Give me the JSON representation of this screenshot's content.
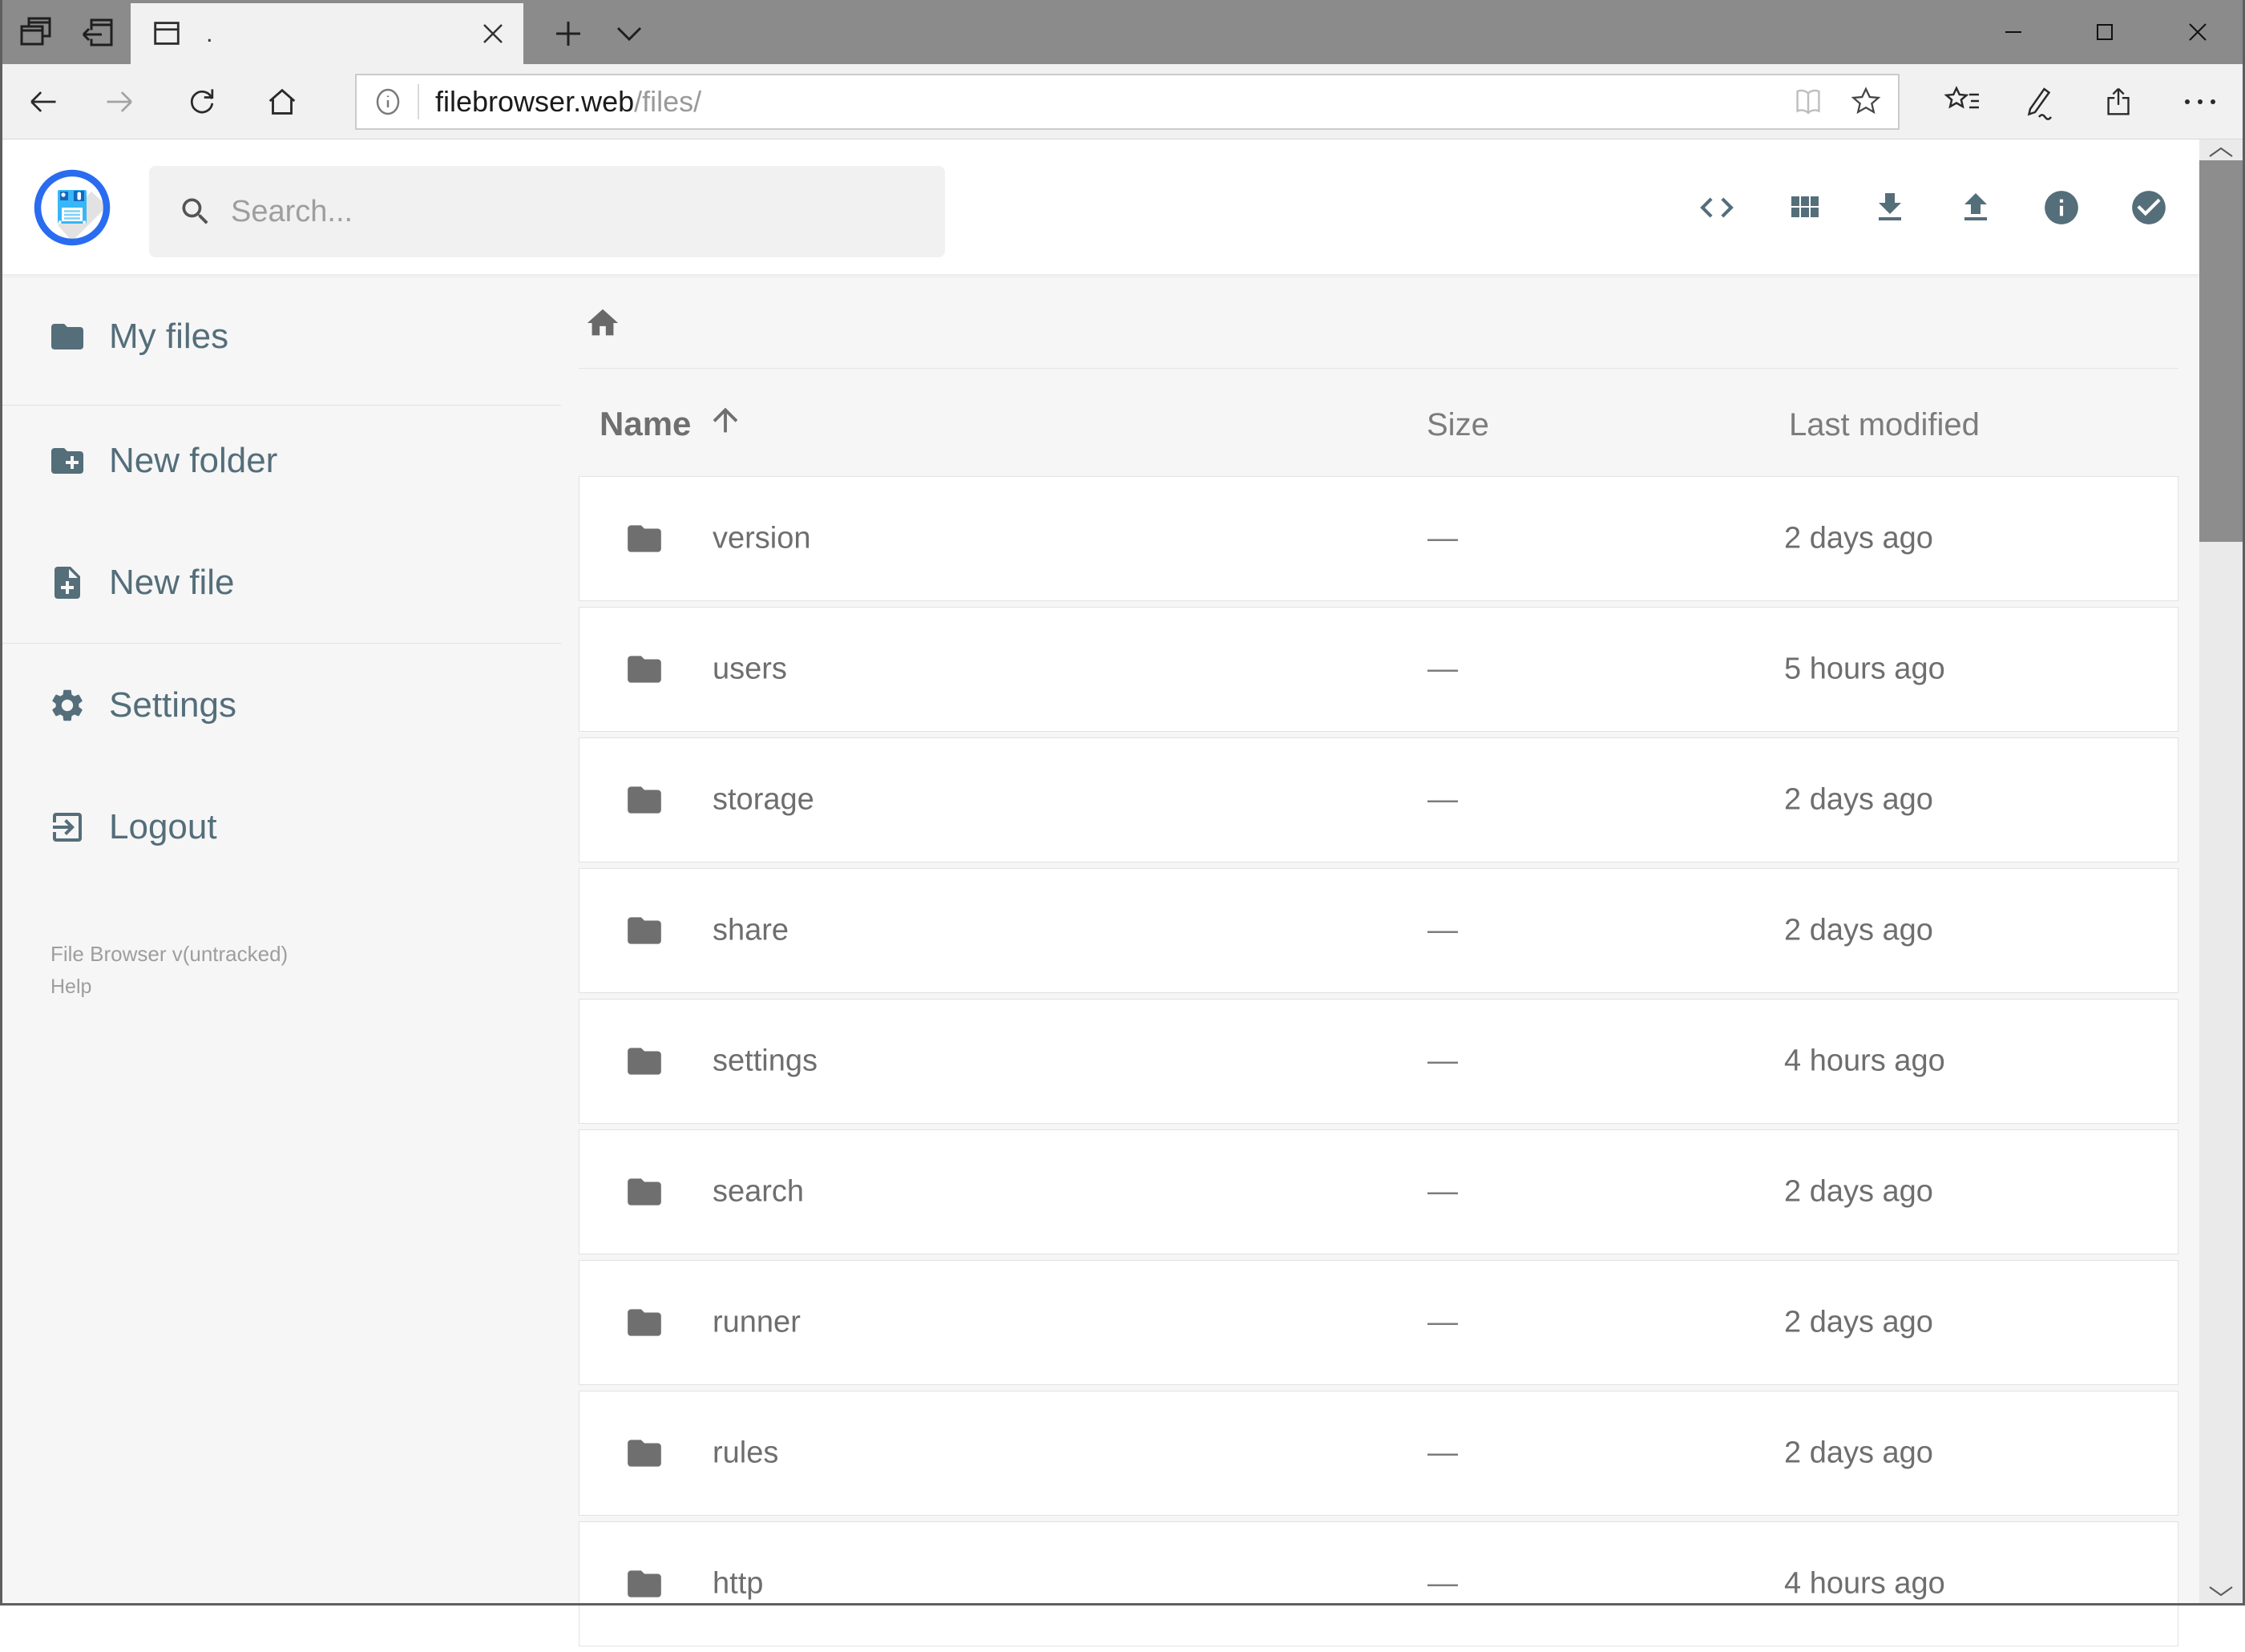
{
  "browser": {
    "tab_title": ".",
    "url": {
      "host": "filebrowser.web",
      "path": "/files/"
    }
  },
  "app": {
    "search_placeholder": "Search...",
    "toolbar_icons": [
      "code",
      "grid-view",
      "download",
      "upload",
      "info",
      "check-circle"
    ],
    "sidebar": {
      "items": [
        {
          "label": "My files",
          "icon": "folder"
        },
        {
          "label": "New folder",
          "icon": "create-new-folder"
        },
        {
          "label": "New file",
          "icon": "note-add"
        },
        {
          "label": "Settings",
          "icon": "settings-gear"
        },
        {
          "label": "Logout",
          "icon": "exit-to-app"
        }
      ],
      "footer": {
        "version": "File Browser v(untracked)",
        "help": "Help"
      }
    },
    "listing": {
      "columns": {
        "name": "Name",
        "size": "Size",
        "modified": "Last modified"
      },
      "sort": {
        "column": "Name",
        "direction": "ascending"
      },
      "rows": [
        {
          "name": "version",
          "size": "—",
          "modified": "2 days ago"
        },
        {
          "name": "users",
          "size": "—",
          "modified": "5 hours ago"
        },
        {
          "name": "storage",
          "size": "—",
          "modified": "2 days ago"
        },
        {
          "name": "share",
          "size": "—",
          "modified": "2 days ago"
        },
        {
          "name": "settings",
          "size": "—",
          "modified": "4 hours ago"
        },
        {
          "name": "search",
          "size": "—",
          "modified": "2 days ago"
        },
        {
          "name": "runner",
          "size": "—",
          "modified": "2 days ago"
        },
        {
          "name": "rules",
          "size": "—",
          "modified": "2 days ago"
        },
        {
          "name": "http",
          "size": "—",
          "modified": "4 hours ago"
        }
      ]
    }
  },
  "colors": {
    "accent": "#546e7a",
    "logo_ring_blue": "#2a6cf0",
    "logo_floppy_blue": "#38b6f6",
    "frame_gray": "#8b8b8b",
    "chrome_bg": "#f1f1f1",
    "content_bg": "#f6f6f6",
    "row_text": "#6e6e6e"
  }
}
